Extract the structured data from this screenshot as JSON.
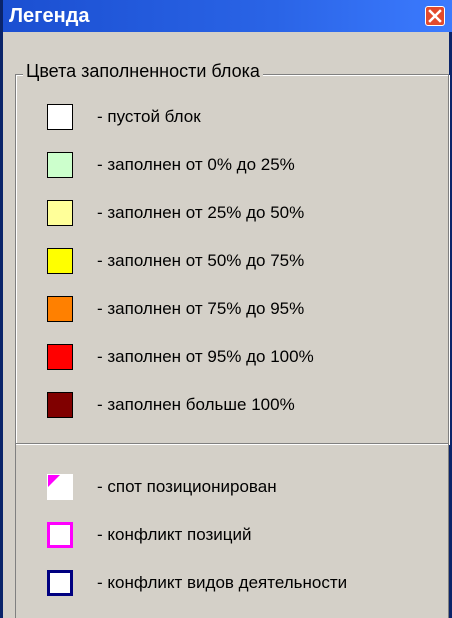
{
  "window": {
    "title": "Легенда",
    "close_icon": "close-icon"
  },
  "fill_group": {
    "title": "Цвета заполненности блока",
    "items": [
      {
        "label": "- пустой блок",
        "color": "#ffffff"
      },
      {
        "label": "- заполнен от 0% до 25%",
        "color": "#ccffcc"
      },
      {
        "label": "- заполнен от 25% до 50%",
        "color": "#ffff99"
      },
      {
        "label": "- заполнен от 50% до 75%",
        "color": "#ffff00"
      },
      {
        "label": "- заполнен от 75% до 95%",
        "color": "#ff8000"
      },
      {
        "label": "- заполнен от 95% до 100%",
        "color": "#ff0000"
      },
      {
        "label": "- заполнен больше 100%",
        "color": "#800000"
      }
    ]
  },
  "status_items": [
    {
      "label": "- спот позиционирован",
      "fill": "#ffffff",
      "border": "#ffffff",
      "corner": "#ff00ff"
    },
    {
      "label": "- конфликт позиций",
      "fill": "#ffffff",
      "border": "#ff00ff"
    },
    {
      "label": "- конфликт видов деятельности",
      "fill": "#ffffff",
      "border": "#000080"
    }
  ]
}
